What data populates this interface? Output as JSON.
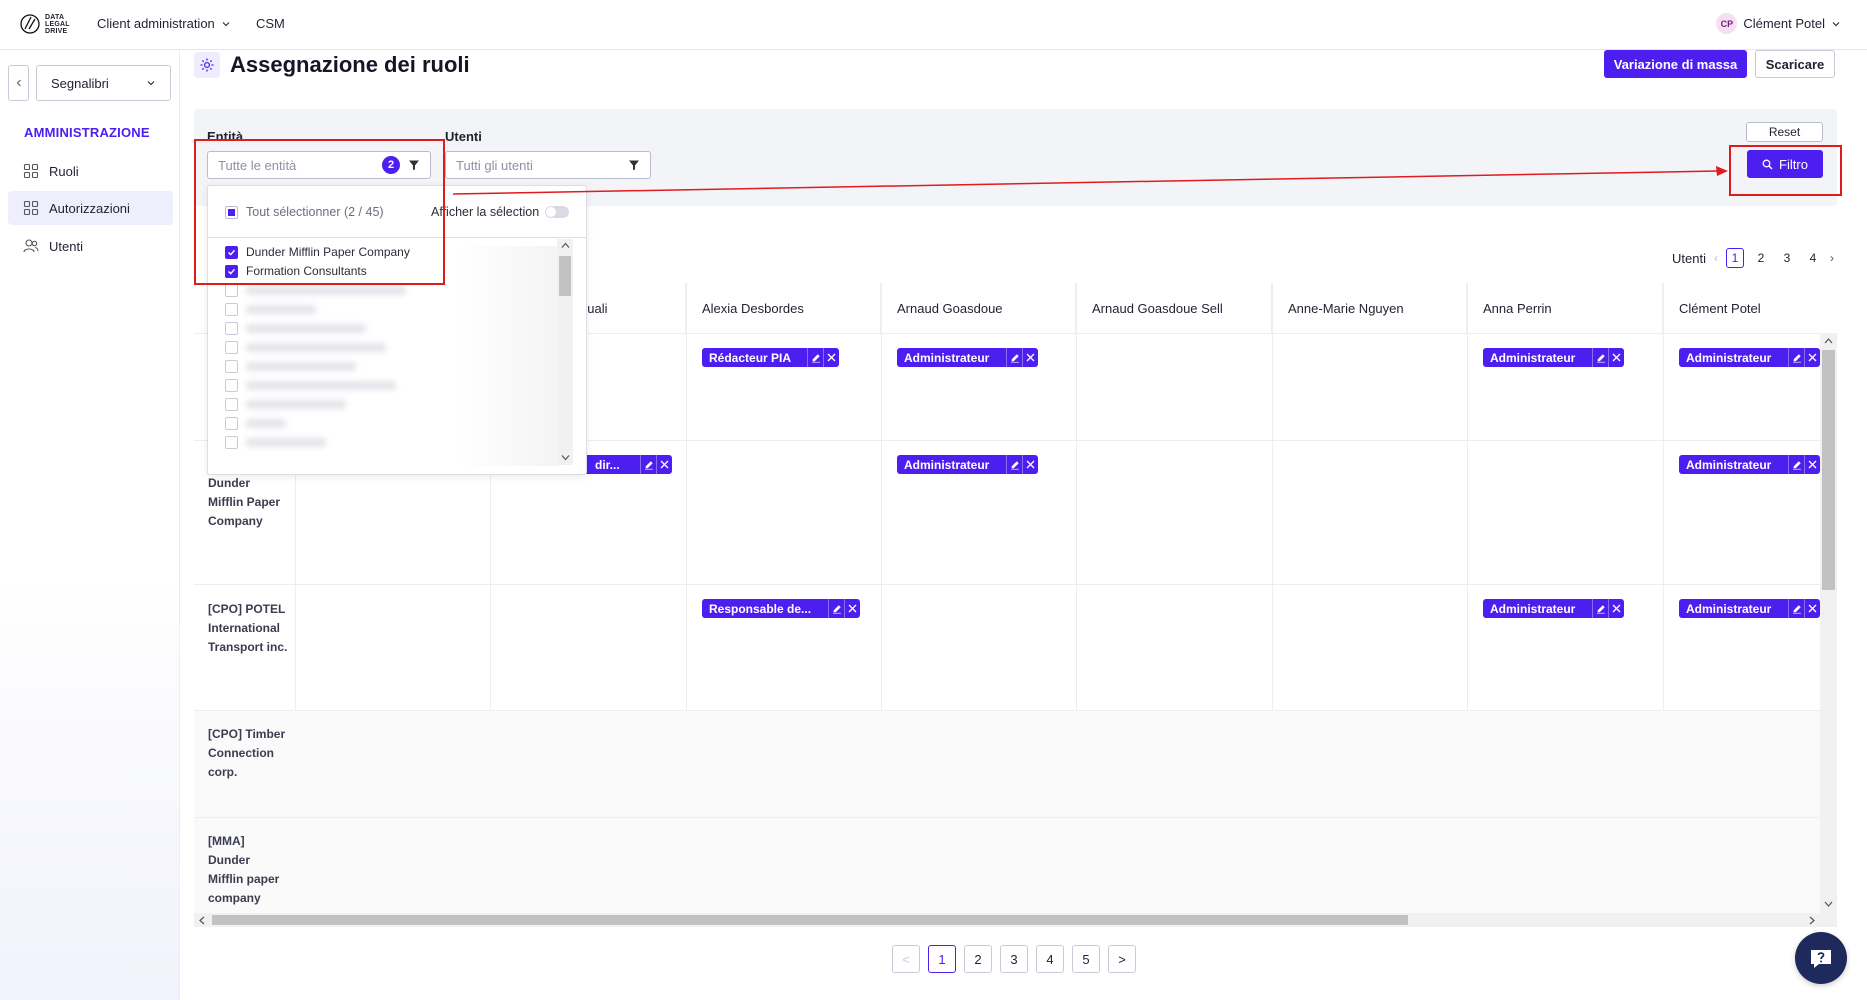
{
  "header": {
    "logo_text": [
      "DATA",
      "LEGAL",
      "DRIVE"
    ],
    "client_menu": "Client administration",
    "csm": "CSM",
    "user_initials": "CP",
    "user_name": "Clément Potel"
  },
  "sidebar": {
    "bookmarks": "Segnalibri",
    "section_title": "AMMINISTRAZIONE",
    "items": [
      {
        "label": "Ruoli",
        "icon": "grid-icon"
      },
      {
        "label": "Autorizzazioni",
        "icon": "grid-icon"
      },
      {
        "label": "Utenti",
        "icon": "users-icon"
      }
    ]
  },
  "page": {
    "title": "Assegnazione dei ruoli",
    "mass_button": "Variazione di massa",
    "download_button": "Scaricare"
  },
  "filters": {
    "entity_label": "Entità",
    "entity_placeholder": "Tutte le entità",
    "entity_count": "2",
    "users_label": "Utenti",
    "users_placeholder": "Tutti gli utenti",
    "reset": "Reset",
    "filter": "Filtro"
  },
  "dropdown": {
    "select_all": "Tout sélectionner (2 / 45)",
    "show_selection": "Afficher la sélection",
    "checked_items": [
      "Dunder Mifflin Paper Company",
      "Formation Consultants"
    ]
  },
  "pager_top": {
    "label": "Utenti",
    "pages": [
      "1",
      "2",
      "3",
      "4"
    ],
    "current": "1"
  },
  "table": {
    "columns": [
      "ouali",
      "Alexia Desbordes",
      "Arnaud Goasdoue",
      "Arnaud Goasdoue Sell",
      "Anne-Marie Nguyen",
      "Anna Perrin",
      "Clément Potel"
    ],
    "rows": [
      {
        "label": "",
        "chips": [
          {
            "col": 1,
            "text": "Rédacteur PIA"
          },
          {
            "col": 2,
            "text": "Administrateur"
          },
          {
            "col": 5,
            "text": "Administrateur"
          },
          {
            "col": 6,
            "text": "Administrateur"
          }
        ]
      },
      {
        "label": "Dunder Mifflin Paper Company",
        "chips": [
          {
            "col": 0,
            "text": "dir..."
          },
          {
            "col": 2,
            "text": "Administrateur"
          },
          {
            "col": 6,
            "text": "Administrateur"
          }
        ]
      },
      {
        "label": "[CPO] POTEL International Transport inc.",
        "chips": [
          {
            "col": 1,
            "text": "Responsable de..."
          },
          {
            "col": 5,
            "text": "Administrateur"
          },
          {
            "col": 6,
            "text": "Administrateur"
          }
        ]
      },
      {
        "label": "[CPO] Timber Connection corp.",
        "chips": []
      },
      {
        "label": "[MMA] Dunder Mifflin paper company",
        "chips": []
      }
    ]
  },
  "pager_bottom": {
    "pages": [
      "1",
      "2",
      "3",
      "4",
      "5"
    ],
    "current": "1",
    "prev": "<",
    "next": ">"
  },
  "colors": {
    "accent": "#4c1ff0",
    "annotation": "#e01b1b"
  }
}
